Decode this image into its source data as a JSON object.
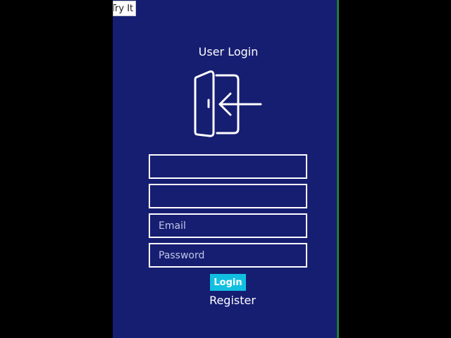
{
  "header": {
    "try_it_label": "Try It"
  },
  "login": {
    "title": "User Login",
    "icon": "door-enter-icon",
    "fields": [
      {
        "value": "",
        "placeholder": ""
      },
      {
        "value": "",
        "placeholder": ""
      },
      {
        "value": "",
        "placeholder": "Email"
      },
      {
        "value": "",
        "placeholder": "Password"
      }
    ],
    "login_button_label": "Login",
    "register_label": "Register"
  },
  "colors": {
    "page_background": "#000000",
    "panel_background": "#161e72",
    "panel_edge": "#1f7a3e",
    "accent_button": "#11c0e0",
    "text": "#ffffff"
  }
}
